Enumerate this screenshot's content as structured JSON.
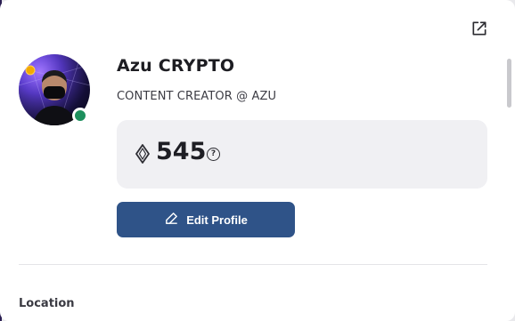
{
  "profile": {
    "name": "Azu CRYPTO",
    "subtitle": "CONTENT CREATOR @ AZU",
    "points": "545",
    "help_glyph": "?",
    "edit_label": "Edit Profile",
    "location_label": "Location",
    "status": "online",
    "status_color": "#1d8f5d"
  },
  "colors": {
    "primary_button": "#2f5388",
    "points_box": "#f0f0f3",
    "card_bg": "#ffffff"
  },
  "icons": {
    "external": "external-link-icon",
    "points": "diamond-icon",
    "help": "question-circle-icon",
    "edit": "pencil-icon"
  }
}
